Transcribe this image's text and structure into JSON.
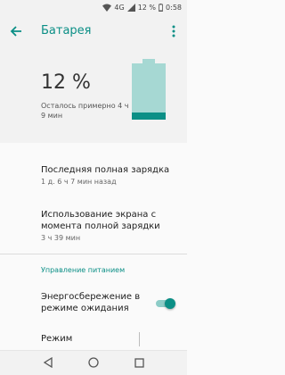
{
  "status_bar": {
    "network_label": "4G",
    "battery_percent": "12 %",
    "time": "0:58",
    "icons": [
      "wifi-icon",
      "signal-icon",
      "battery-icon"
    ]
  },
  "app_bar": {
    "title": "Батарея",
    "back_icon": "arrow-back-icon",
    "more_icon": "more-vert-icon"
  },
  "battery_header": {
    "percent": "12 %",
    "remaining": "Осталось примерно 4 ч 9 мин",
    "level": 0.12
  },
  "items": [
    {
      "title": "Последняя полная зарядка",
      "summary": "1 д. 6 ч 7 мин назад"
    },
    {
      "title": "Использование экрана с момента полной зарядки",
      "summary": "3 ч 39 мин"
    }
  ],
  "power_section": {
    "header": "Управление питанием",
    "standby_saver": {
      "title": "Энергосбережение в режиме ожидания",
      "enabled": true
    },
    "mode": {
      "title": "Режим"
    }
  },
  "nav": {
    "back_icon": "nav-back-icon",
    "home_icon": "nav-home-icon",
    "recents_icon": "nav-recents-icon"
  },
  "colors": {
    "accent": "#0b8f86",
    "battery_fill": "#a6d8d3",
    "header_bg": "#f2f2f2"
  }
}
